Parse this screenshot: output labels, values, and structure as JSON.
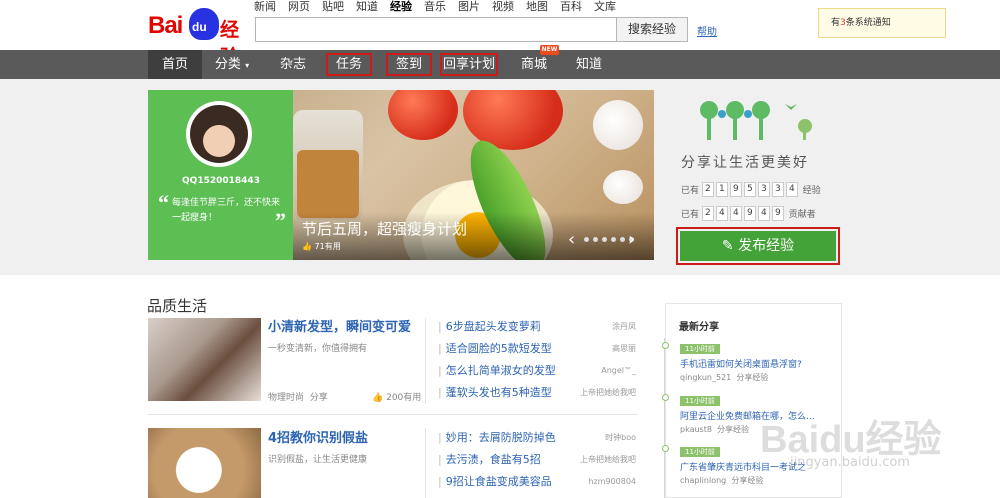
{
  "brand": {
    "logo_bai": "Bai",
    "logo_du": "du",
    "logo_jingyan": "经验"
  },
  "top_nav": [
    "新闻",
    "网页",
    "贴吧",
    "知道",
    "经验",
    "音乐",
    "图片",
    "视频",
    "地图",
    "百科",
    "文库"
  ],
  "search": {
    "placeholder": "",
    "button": "搜索经验",
    "help": "帮助"
  },
  "notice": {
    "prefix": "有",
    "count": "3",
    "suffix": "条系统通知"
  },
  "navbar": {
    "home": "首页",
    "category": "分类",
    "magazine": "杂志",
    "task": "任务",
    "checkin": "签到",
    "reward": "回享计划",
    "mall": "商城",
    "know": "知道",
    "new_badge": "NEW"
  },
  "profile": {
    "username": "QQ1520018443",
    "quote": "每逢佳节胖三斤，还不快来一起瘦身！"
  },
  "banner": {
    "title": "节后五周，超强瘦身计划",
    "useful": "71有用"
  },
  "side": {
    "slogan": "分享让生活更美好",
    "stat1_prefix": "已有",
    "stat1_digits": [
      "2",
      "1",
      "9",
      "5",
      "3",
      "3",
      "4"
    ],
    "stat1_suffix": "经验",
    "stat2_prefix": "已有",
    "stat2_digits": [
      "2",
      "4",
      "4",
      "9",
      "4",
      "9"
    ],
    "stat2_suffix": "贡献者",
    "publish": "发布经验"
  },
  "section": {
    "title": "品质生活"
  },
  "articles": [
    {
      "title": "小清新发型，瞬间变可爱",
      "desc": "一秒变清新，你值得拥有",
      "category": "物理时尚",
      "share": "分享",
      "useful": "200有用",
      "list": [
        {
          "t": "6步盘起头发变萝莉",
          "a": "涂丹凤"
        },
        {
          "t": "适合圆脸的5款短发型",
          "a": "高思丽"
        },
        {
          "t": "怎么扎简单淑女的发型",
          "a": "Angel™_"
        },
        {
          "t": "蓬软头发也有5种造型",
          "a": "上帝把她给我吧"
        }
      ]
    },
    {
      "title": "4招教你识别假盐",
      "desc": "识别假盐，让生活更健康",
      "list": [
        {
          "t": "妙用：去屑防脱防掉色",
          "a": "时钟boo"
        },
        {
          "t": "去污渍，食盐有5招",
          "a": "上帝把她给我吧"
        },
        {
          "t": "9招让食盐变成美容品",
          "a": "hzm900804"
        }
      ]
    }
  ],
  "latest": {
    "title": "最新分享",
    "entries": [
      {
        "time": "11小时前",
        "title": "手机迅雷如何关闭桌面悬浮窗?",
        "user": "qingkun_521",
        "action": "分享经验"
      },
      {
        "time": "11小时前",
        "title": "阿里云企业免费邮箱在哪，怎么...",
        "user": "pkaust8",
        "action": "分享经验"
      },
      {
        "time": "11小时前",
        "title": "广东省肇庆青远市科目一考试之",
        "user": "chaplinlong",
        "action": "分享经验"
      }
    ]
  },
  "watermark": {
    "main": "Baidu经验",
    "sub": "jingyan.baidu.com"
  }
}
